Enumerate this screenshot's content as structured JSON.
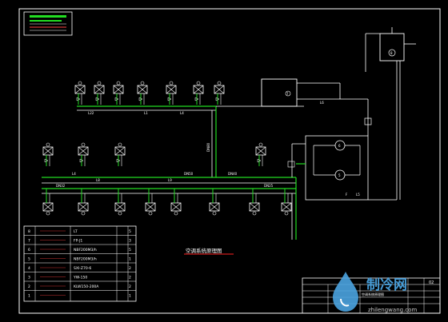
{
  "drawing": {
    "title": "空调系统原理图",
    "colors": {
      "background": "#000000",
      "frame": "#ffffff",
      "supply_pipe": "#22dd22",
      "return_pipe": "#ffffff",
      "title_underline": "#ff2222",
      "text": "#ffffff",
      "watermark": "#4aa3e0"
    }
  },
  "equipment_table": {
    "rows": [
      {
        "no": "8",
        "name": "",
        "spec": "LT",
        "unit": "",
        "qty": "5"
      },
      {
        "no": "7",
        "name": "",
        "spec": "FP-J1",
        "unit": "",
        "qty": "3"
      },
      {
        "no": "6",
        "name": "",
        "spec": "NBF200M3/h",
        "unit": "",
        "qty": "5"
      },
      {
        "no": "5",
        "name": "",
        "spec": "NBF200M3/h",
        "unit": "",
        "qty": "1"
      },
      {
        "no": "4",
        "name": "",
        "spec": "SXI-Z70-6",
        "unit": "",
        "qty": "2"
      },
      {
        "no": "3",
        "name": "",
        "spec": "YW-150",
        "unit": "",
        "qty": "2"
      },
      {
        "no": "2",
        "name": "",
        "spec": "KLW150-200A",
        "unit": "",
        "qty": "2"
      },
      {
        "no": "1",
        "name": "",
        "spec": "",
        "unit": "",
        "qty": "1"
      }
    ]
  },
  "pipe_labels": {
    "top_branch": [
      "L22",
      "L1",
      "L4"
    ],
    "main_header": [
      "L4",
      "L8",
      "L9"
    ],
    "riser": "DN80",
    "sizes": [
      "DN50",
      "DN40",
      "DN32",
      "DN25"
    ],
    "pump_room": [
      "L6",
      "F",
      "L5"
    ]
  },
  "equipment_numbers": {
    "tank": "7",
    "expansion": "8",
    "pump_a": "6",
    "pump_b": "5"
  },
  "title_block": {
    "project": "空调系统原理图",
    "code": "02"
  },
  "watermark": {
    "brand": "制冷网",
    "url": "zhilengwang.com"
  }
}
